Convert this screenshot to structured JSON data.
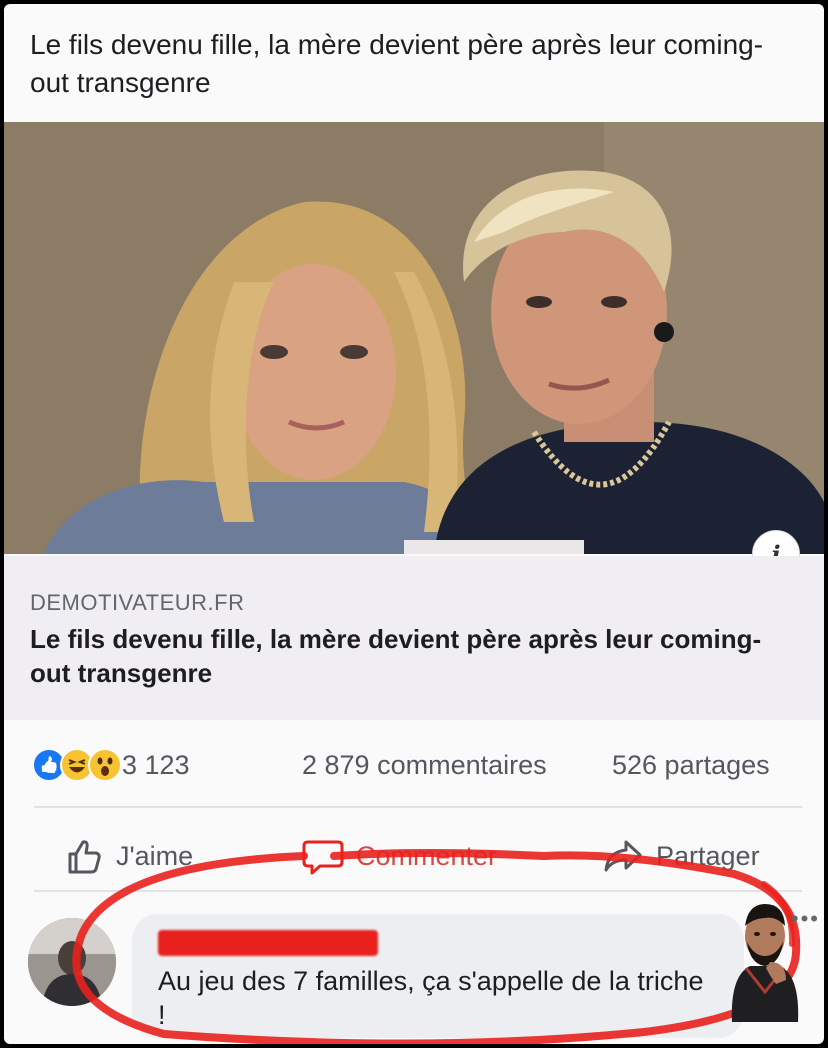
{
  "post": {
    "text": "Le fils devenu fille, la mère devient père après leur coming-out transgenre"
  },
  "link_preview": {
    "domain": "DEMOTIVATEUR.FR",
    "title": "Le fils devenu fille, la mère devient père après leur coming-out transgenre",
    "info_icon": "i"
  },
  "stats": {
    "reactions": [
      "like-icon",
      "haha-icon",
      "wow-icon"
    ],
    "reaction_count": "3 123",
    "comments": "2 879 commentaires",
    "shares": "526 partages"
  },
  "actions": {
    "like": "J'aime",
    "comment": "Commenter",
    "share": "Partager"
  },
  "comment": {
    "text": "Au jeu des 7 familles, ça s'appelle de la triche !"
  },
  "colors": {
    "annotation_red": "#e8211e",
    "facebook_blue": "#1877f2",
    "reaction_yellow": "#f7c330"
  }
}
